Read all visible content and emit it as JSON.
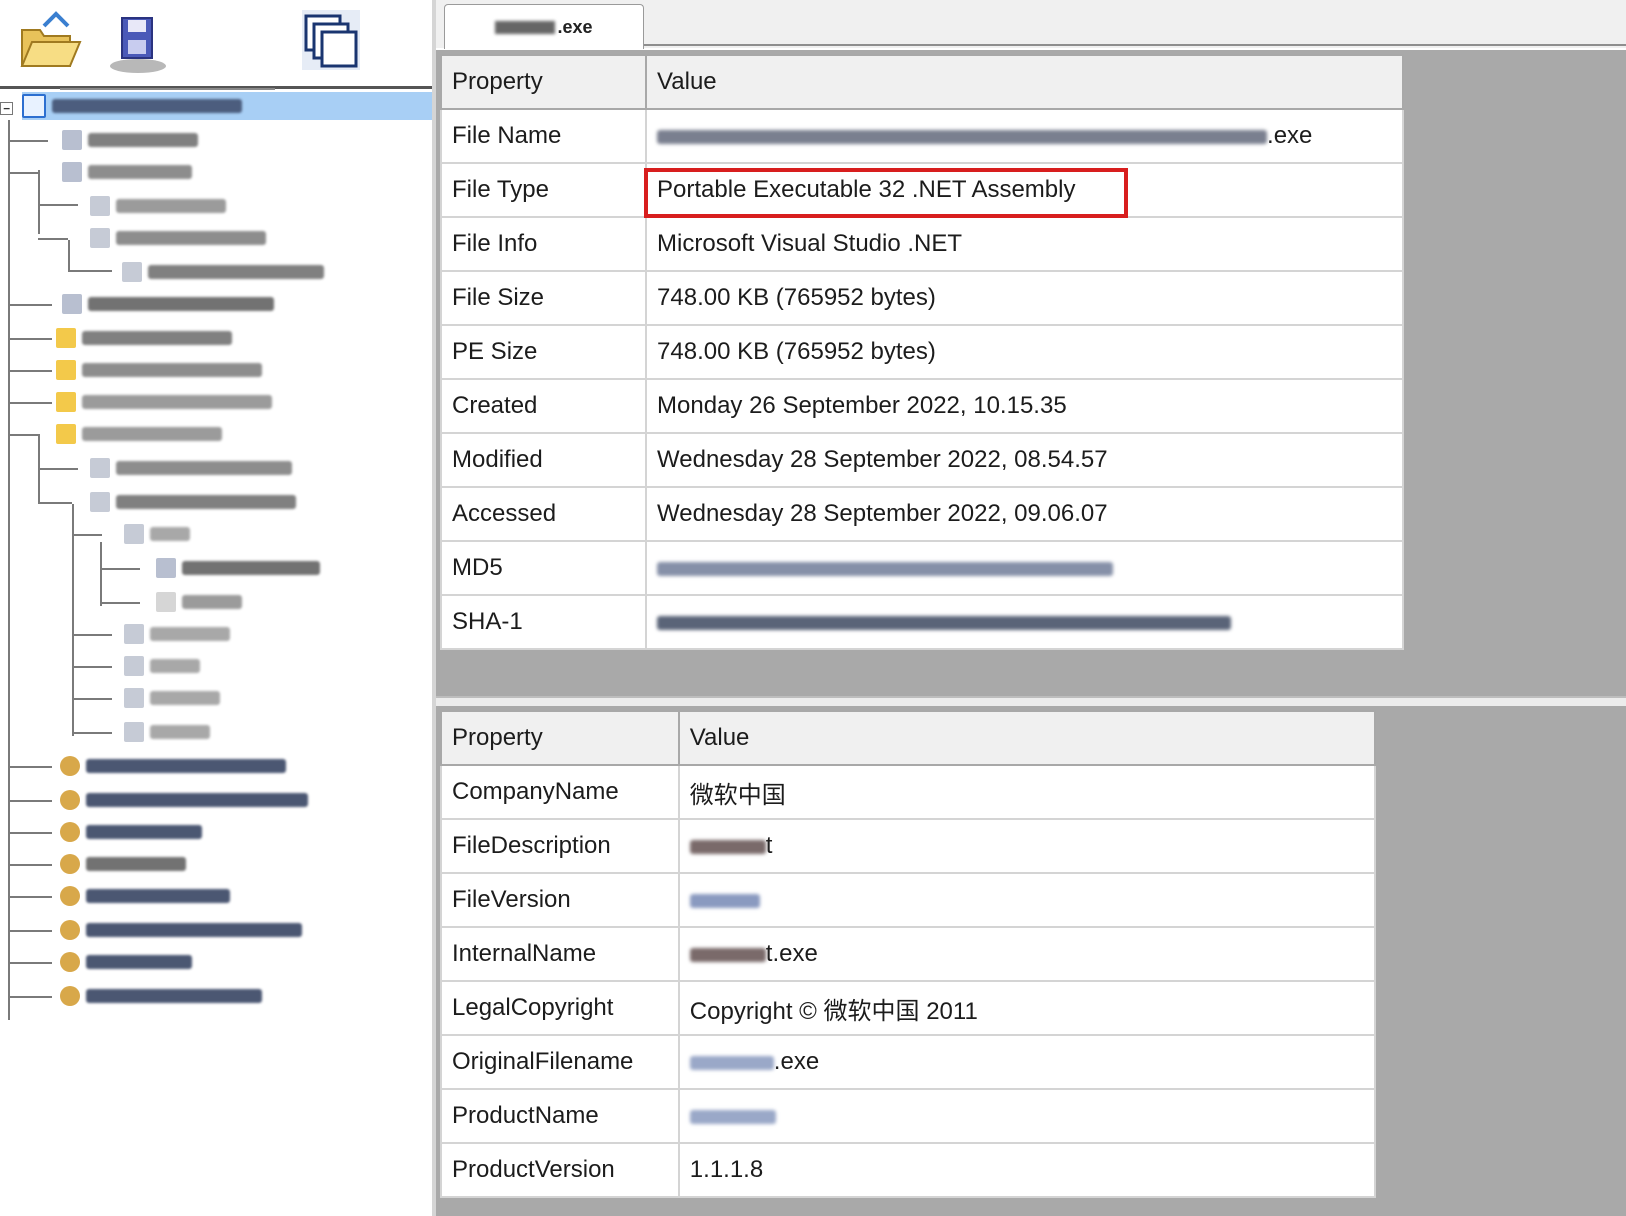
{
  "tab": {
    "title_suffix": ".exe"
  },
  "file_table": {
    "headers": {
      "property": "Property",
      "value": "Value"
    },
    "rows": [
      {
        "property": "File Name",
        "value": ".exe"
      },
      {
        "property": "File Type",
        "value": "Portable Executable 32 .NET Assembly"
      },
      {
        "property": "File Info",
        "value": "Microsoft Visual Studio .NET"
      },
      {
        "property": "File Size",
        "value": "748.00 KB (765952 bytes)"
      },
      {
        "property": "PE Size",
        "value": "748.00 KB (765952 bytes)"
      },
      {
        "property": "Created",
        "value": "Monday 26 September 2022, 10.15.35"
      },
      {
        "property": "Modified",
        "value": "Wednesday 28 September 2022, 08.54.57"
      },
      {
        "property": "Accessed",
        "value": "Wednesday 28 September 2022, 09.06.07"
      },
      {
        "property": "MD5",
        "value": ""
      },
      {
        "property": "SHA-1",
        "value": ""
      }
    ]
  },
  "version_table": {
    "headers": {
      "property": "Property",
      "value": "Value"
    },
    "rows": [
      {
        "property": "CompanyName",
        "value": "微软中国"
      },
      {
        "property": "FileDescription",
        "value": "t"
      },
      {
        "property": "FileVersion",
        "value": ""
      },
      {
        "property": "InternalName",
        "value": "t.exe"
      },
      {
        "property": "LegalCopyright",
        "value": "Copyright © 微软中国 2011"
      },
      {
        "property": "OriginalFilename",
        "value": ".exe"
      },
      {
        "property": "ProductName",
        "value": ""
      },
      {
        "property": "ProductVersion",
        "value": "1.1.1.8"
      }
    ]
  },
  "toolbar": {
    "icons": [
      "open-folder-icon",
      "save-disk-icon",
      "windows-icon"
    ]
  },
  "colors": {
    "selection": "#a8cff5",
    "highlight_border": "#d81e1e",
    "header_bg": "#f0f0f0",
    "panel_bg": "#a9a9a9"
  }
}
